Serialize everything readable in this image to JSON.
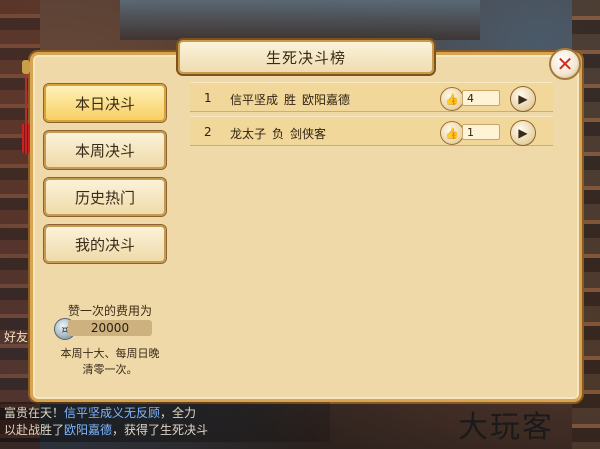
{
  "title": "生死决斗榜",
  "tabs": [
    {
      "label": "本日决斗",
      "active": true
    },
    {
      "label": "本周决斗",
      "active": false
    },
    {
      "label": "历史热门",
      "active": false
    },
    {
      "label": "我的决斗",
      "active": false
    }
  ],
  "cost": {
    "label": "赞一次的费用为",
    "amount": "20000",
    "icon": "silver-coin-icon"
  },
  "reset_note_line1": "本周十大、每周日晚",
  "reset_note_line2": "清零一次。",
  "duels": [
    {
      "rank": "1",
      "player1": "信平坚成",
      "result": "胜",
      "player2": "欧阳嘉德",
      "likes": "4"
    },
    {
      "rank": "2",
      "player1": "龙太子",
      "result": "负",
      "player2": "剑侠客",
      "likes": "1"
    }
  ],
  "chat": {
    "line1_pre": "富贵在天！",
    "line1_name": "信平坚成义无反顾",
    "line1_post": "，全力",
    "line2_pre": "以赴战胜了",
    "line2_name": "欧阳嘉德",
    "line2_post": "，获得了生死决斗"
  },
  "side_label": "好友",
  "watermark": "大玩客",
  "colors": {
    "active_tab": "#f7d063",
    "panel": "#efd9a8",
    "close": "#d22a1c",
    "link": "#7fb6ff"
  }
}
